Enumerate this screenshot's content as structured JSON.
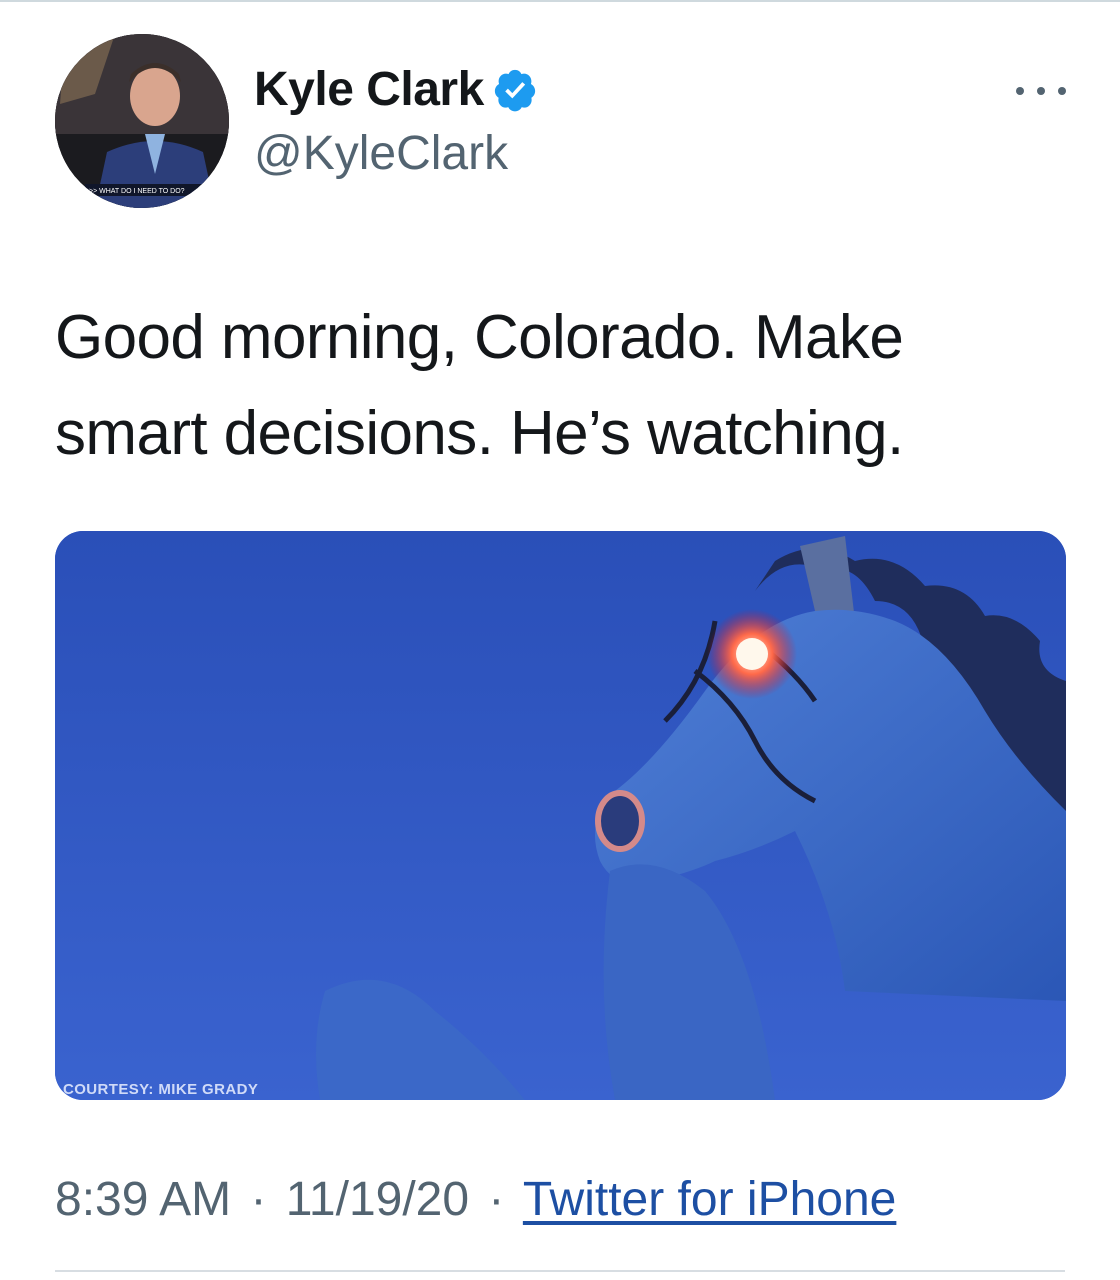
{
  "author": {
    "display_name": "Kyle Clark",
    "handle": "@KyleClark",
    "verified": true,
    "avatar_caption": ">> WHAT DO I NEED TO DO?"
  },
  "tweet": {
    "text": "Good morning, Colorado. Make smart decisions. He’s watching.",
    "image_credit": "COURTESY: MIKE GRADY",
    "time": "8:39 AM",
    "date": "11/19/20",
    "separator": "·",
    "source": "Twitter for iPhone"
  },
  "colors": {
    "link": "#1d4fa3",
    "verified": "#1d9bf0",
    "secondary_text": "#536471",
    "image_sky": "#2f55c0"
  },
  "icons": {
    "verified": "verified-badge-icon",
    "more": "more-horizontal-icon"
  }
}
